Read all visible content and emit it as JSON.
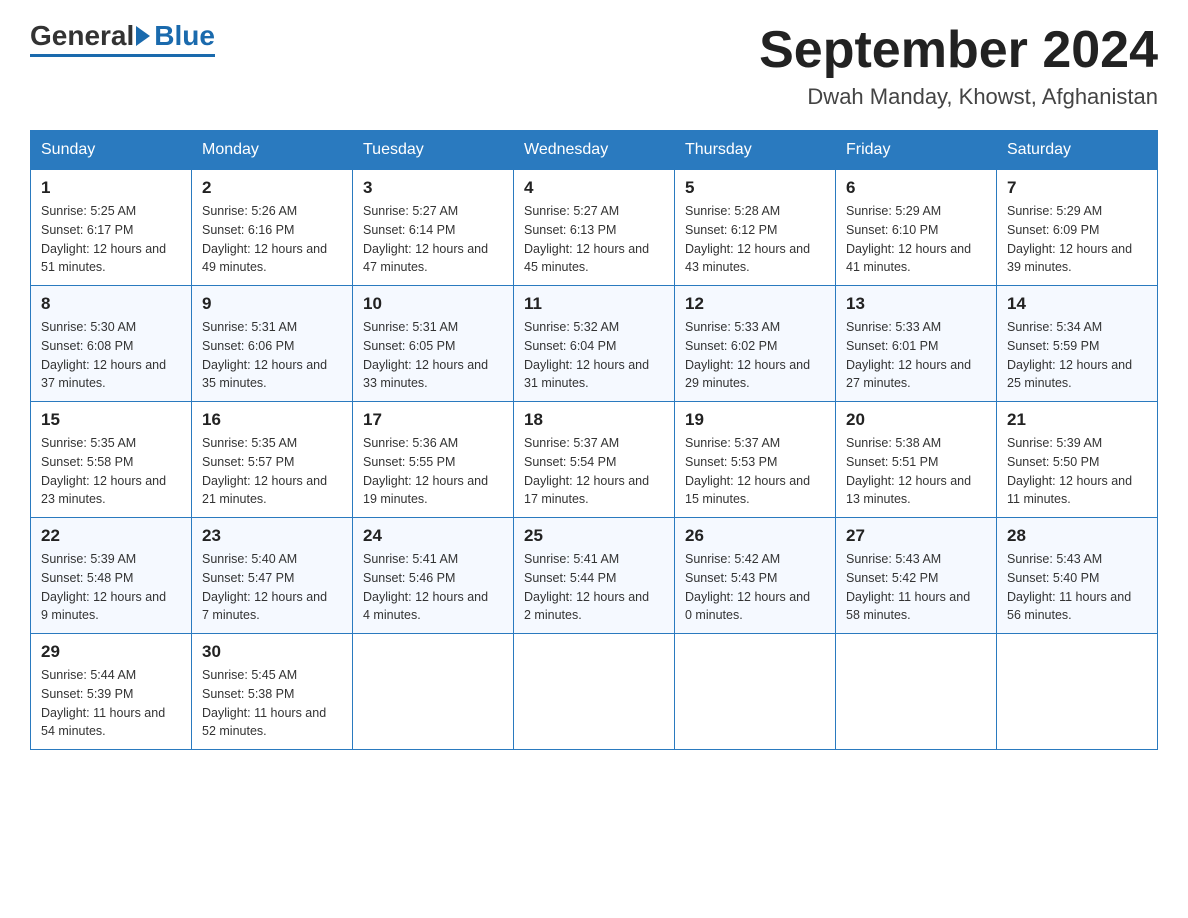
{
  "logo": {
    "general": "General",
    "blue": "Blue"
  },
  "header": {
    "month_year": "September 2024",
    "location": "Dwah Manday, Khowst, Afghanistan"
  },
  "days_of_week": [
    "Sunday",
    "Monday",
    "Tuesday",
    "Wednesday",
    "Thursday",
    "Friday",
    "Saturday"
  ],
  "weeks": [
    [
      {
        "day": "1",
        "sunrise": "5:25 AM",
        "sunset": "6:17 PM",
        "daylight": "12 hours and 51 minutes."
      },
      {
        "day": "2",
        "sunrise": "5:26 AM",
        "sunset": "6:16 PM",
        "daylight": "12 hours and 49 minutes."
      },
      {
        "day": "3",
        "sunrise": "5:27 AM",
        "sunset": "6:14 PM",
        "daylight": "12 hours and 47 minutes."
      },
      {
        "day": "4",
        "sunrise": "5:27 AM",
        "sunset": "6:13 PM",
        "daylight": "12 hours and 45 minutes."
      },
      {
        "day": "5",
        "sunrise": "5:28 AM",
        "sunset": "6:12 PM",
        "daylight": "12 hours and 43 minutes."
      },
      {
        "day": "6",
        "sunrise": "5:29 AM",
        "sunset": "6:10 PM",
        "daylight": "12 hours and 41 minutes."
      },
      {
        "day": "7",
        "sunrise": "5:29 AM",
        "sunset": "6:09 PM",
        "daylight": "12 hours and 39 minutes."
      }
    ],
    [
      {
        "day": "8",
        "sunrise": "5:30 AM",
        "sunset": "6:08 PM",
        "daylight": "12 hours and 37 minutes."
      },
      {
        "day": "9",
        "sunrise": "5:31 AM",
        "sunset": "6:06 PM",
        "daylight": "12 hours and 35 minutes."
      },
      {
        "day": "10",
        "sunrise": "5:31 AM",
        "sunset": "6:05 PM",
        "daylight": "12 hours and 33 minutes."
      },
      {
        "day": "11",
        "sunrise": "5:32 AM",
        "sunset": "6:04 PM",
        "daylight": "12 hours and 31 minutes."
      },
      {
        "day": "12",
        "sunrise": "5:33 AM",
        "sunset": "6:02 PM",
        "daylight": "12 hours and 29 minutes."
      },
      {
        "day": "13",
        "sunrise": "5:33 AM",
        "sunset": "6:01 PM",
        "daylight": "12 hours and 27 minutes."
      },
      {
        "day": "14",
        "sunrise": "5:34 AM",
        "sunset": "5:59 PM",
        "daylight": "12 hours and 25 minutes."
      }
    ],
    [
      {
        "day": "15",
        "sunrise": "5:35 AM",
        "sunset": "5:58 PM",
        "daylight": "12 hours and 23 minutes."
      },
      {
        "day": "16",
        "sunrise": "5:35 AM",
        "sunset": "5:57 PM",
        "daylight": "12 hours and 21 minutes."
      },
      {
        "day": "17",
        "sunrise": "5:36 AM",
        "sunset": "5:55 PM",
        "daylight": "12 hours and 19 minutes."
      },
      {
        "day": "18",
        "sunrise": "5:37 AM",
        "sunset": "5:54 PM",
        "daylight": "12 hours and 17 minutes."
      },
      {
        "day": "19",
        "sunrise": "5:37 AM",
        "sunset": "5:53 PM",
        "daylight": "12 hours and 15 minutes."
      },
      {
        "day": "20",
        "sunrise": "5:38 AM",
        "sunset": "5:51 PM",
        "daylight": "12 hours and 13 minutes."
      },
      {
        "day": "21",
        "sunrise": "5:39 AM",
        "sunset": "5:50 PM",
        "daylight": "12 hours and 11 minutes."
      }
    ],
    [
      {
        "day": "22",
        "sunrise": "5:39 AM",
        "sunset": "5:48 PM",
        "daylight": "12 hours and 9 minutes."
      },
      {
        "day": "23",
        "sunrise": "5:40 AM",
        "sunset": "5:47 PM",
        "daylight": "12 hours and 7 minutes."
      },
      {
        "day": "24",
        "sunrise": "5:41 AM",
        "sunset": "5:46 PM",
        "daylight": "12 hours and 4 minutes."
      },
      {
        "day": "25",
        "sunrise": "5:41 AM",
        "sunset": "5:44 PM",
        "daylight": "12 hours and 2 minutes."
      },
      {
        "day": "26",
        "sunrise": "5:42 AM",
        "sunset": "5:43 PM",
        "daylight": "12 hours and 0 minutes."
      },
      {
        "day": "27",
        "sunrise": "5:43 AM",
        "sunset": "5:42 PM",
        "daylight": "11 hours and 58 minutes."
      },
      {
        "day": "28",
        "sunrise": "5:43 AM",
        "sunset": "5:40 PM",
        "daylight": "11 hours and 56 minutes."
      }
    ],
    [
      {
        "day": "29",
        "sunrise": "5:44 AM",
        "sunset": "5:39 PM",
        "daylight": "11 hours and 54 minutes."
      },
      {
        "day": "30",
        "sunrise": "5:45 AM",
        "sunset": "5:38 PM",
        "daylight": "11 hours and 52 minutes."
      },
      null,
      null,
      null,
      null,
      null
    ]
  ]
}
